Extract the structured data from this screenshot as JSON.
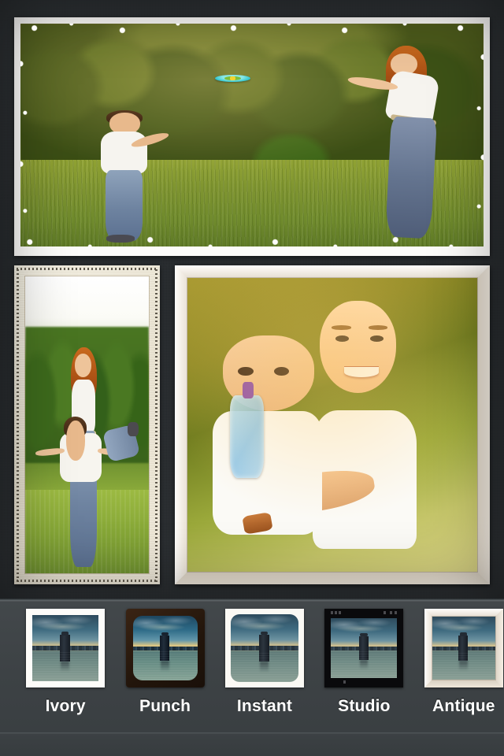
{
  "app": {
    "title": "Photo Frame Collage Editor",
    "background_color": "#292d30",
    "toolbar_color": "#3f4447"
  },
  "collage": {
    "name": "photo-collage",
    "layout": "3-cell: one wide top, one tall left, one square right",
    "photos": [
      {
        "id": "photo-top",
        "caption": "Woman and boy playing frisbee in a sunlit park",
        "frame_style": "White torn-edge",
        "position": "top-wide"
      },
      {
        "id": "photo-left",
        "caption": "Woman giving a boy a piggyback ride on grass",
        "frame_style": "Vintage cream perforated",
        "position": "bottom-left-tall"
      },
      {
        "id": "photo-right",
        "caption": "Woman hugging a boy drinking from a water bottle",
        "frame_style": "Beveled ivory mat",
        "position": "bottom-right-square"
      }
    ]
  },
  "filters": {
    "name": "frame-filter-strip",
    "selected": "",
    "items": [
      {
        "label": "Ivory",
        "frame": "white-mat",
        "icon": "frame-ivory-icon"
      },
      {
        "label": "Punch",
        "frame": "dark-rounded",
        "icon": "frame-punch-icon"
      },
      {
        "label": "Instant",
        "frame": "polaroid",
        "icon": "frame-instant-icon"
      },
      {
        "label": "Studio",
        "frame": "black-border",
        "icon": "frame-studio-icon"
      },
      {
        "label": "Antique",
        "frame": "beveled-cream",
        "icon": "frame-antique-icon"
      }
    ],
    "thumbnail_caption": "Pier piling on calm water at dusk"
  }
}
